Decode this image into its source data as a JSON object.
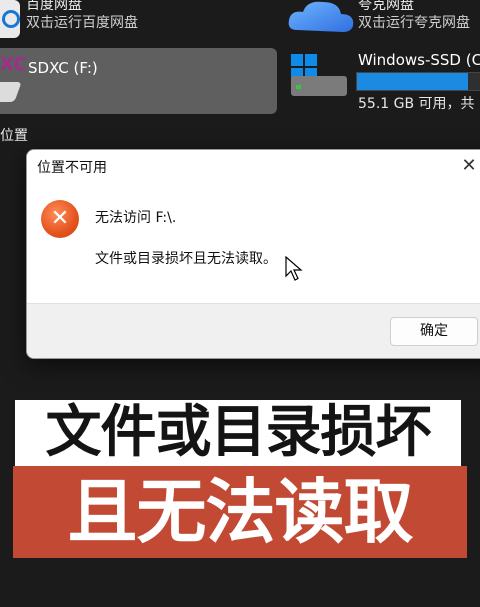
{
  "explorer": {
    "baidu": {
      "name": "百度网盘",
      "desc": "双击运行百度网盘"
    },
    "quark": {
      "name": "夸克网盘",
      "desc": "双击运行夸克网盘"
    },
    "sdxc": {
      "logo_text": "XC",
      "label": "SDXC (F:)"
    },
    "position_label": "位置",
    "windows_ssd": {
      "label": "Windows-SSD (C",
      "free_text": "55.1 GB 可用，共",
      "used_fraction": 0.85
    }
  },
  "dialog": {
    "title": "位置不可用",
    "close_glyph": "✕",
    "error_glyph": "✕",
    "message_line1": "无法访问 F:\\.",
    "message_line2": "文件或目录损坏且无法读取。",
    "ok_label": "确定"
  },
  "caption": {
    "line1": "文件或目录损坏",
    "line2": "且无法读取"
  },
  "colors": {
    "accent_blue": "#1a8be0",
    "error_orange": "#e4531e",
    "caption_red": "#c24a34",
    "background": "#1b1b1b"
  }
}
